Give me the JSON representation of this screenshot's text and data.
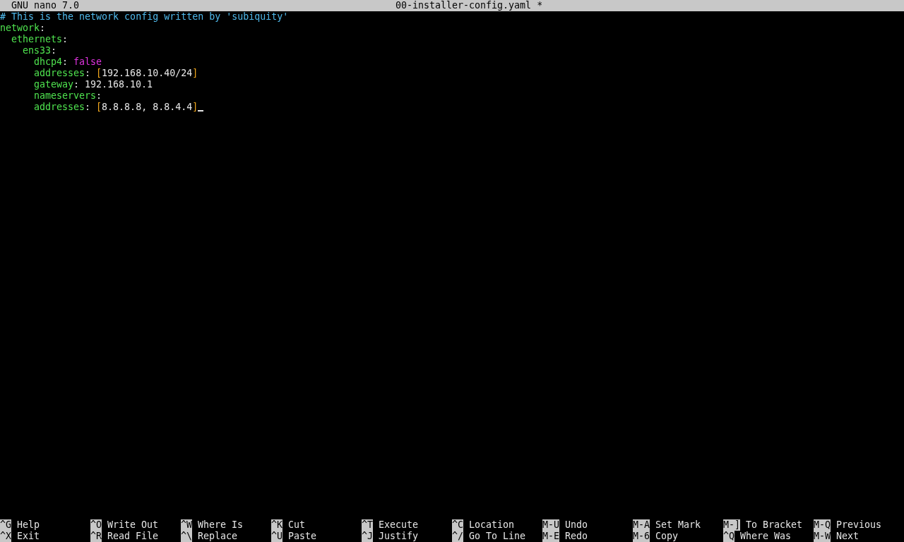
{
  "title_bar": {
    "app": "GNU nano 7.0",
    "file": "00-installer-config.yaml *"
  },
  "lines": [
    {
      "tokens": [
        {
          "kind": "comment",
          "text": "# This is the network config written by 'subiquity'"
        }
      ]
    },
    {
      "tokens": [
        {
          "kind": "key",
          "text": "network"
        },
        {
          "kind": "plain",
          "text": ":"
        }
      ],
      "children": [
        {
          "tokens": [
            {
              "kind": "key",
              "text": "ethernets"
            },
            {
              "kind": "plain",
              "text": ":"
            }
          ],
          "children": [
            {
              "tokens": [
                {
                  "kind": "key",
                  "text": "ens33"
                },
                {
                  "kind": "plain",
                  "text": ":"
                }
              ],
              "children": [
                {
                  "tokens": [
                    {
                      "kind": "key",
                      "text": "dhcp4"
                    },
                    {
                      "kind": "plain",
                      "text": ": "
                    },
                    {
                      "kind": "bool",
                      "text": "false"
                    }
                  ]
                },
                {
                  "tokens": [
                    {
                      "kind": "key",
                      "text": "addresses"
                    },
                    {
                      "kind": "plain",
                      "text": ": "
                    },
                    {
                      "kind": "bracket",
                      "text": "["
                    },
                    {
                      "kind": "plain",
                      "text": "192.168.10.40/24"
                    },
                    {
                      "kind": "bracket",
                      "text": "]"
                    }
                  ]
                },
                {
                  "tokens": [
                    {
                      "kind": "key",
                      "text": "gateway"
                    },
                    {
                      "kind": "plain",
                      "text": ": 192.168.10.1"
                    }
                  ]
                },
                {
                  "tokens": [
                    {
                      "kind": "key",
                      "text": "nameservers"
                    },
                    {
                      "kind": "plain",
                      "text": ":"
                    }
                  ]
                },
                {
                  "tokens": [
                    {
                      "kind": "key",
                      "text": "addresses"
                    },
                    {
                      "kind": "plain",
                      "text": ": "
                    },
                    {
                      "kind": "bracket",
                      "text": "["
                    },
                    {
                      "kind": "plain",
                      "text": "8.8.8.8, 8.8.4.4"
                    },
                    {
                      "kind": "bracket",
                      "text": "]"
                    }
                  ],
                  "cursor": true
                }
              ]
            }
          ]
        }
      ]
    }
  ],
  "shortcut_rows": [
    [
      {
        "key": "^G",
        "label": "Help"
      },
      {
        "key": "^O",
        "label": "Write Out"
      },
      {
        "key": "^W",
        "label": "Where Is"
      },
      {
        "key": "^K",
        "label": "Cut"
      },
      {
        "key": "^T",
        "label": "Execute"
      },
      {
        "key": "^C",
        "label": "Location"
      },
      {
        "key": "M-U",
        "label": "Undo"
      },
      {
        "key": "M-A",
        "label": "Set Mark"
      },
      {
        "key": "M-]",
        "label": "To Bracket"
      },
      {
        "key": "M-Q",
        "label": "Previous"
      }
    ],
    [
      {
        "key": "^X",
        "label": "Exit"
      },
      {
        "key": "^R",
        "label": "Read File"
      },
      {
        "key": "^\\",
        "label": "Replace"
      },
      {
        "key": "^U",
        "label": "Paste"
      },
      {
        "key": "^J",
        "label": "Justify"
      },
      {
        "key": "^/",
        "label": "Go To Line"
      },
      {
        "key": "M-E",
        "label": "Redo"
      },
      {
        "key": "M-6",
        "label": "Copy"
      },
      {
        "key": "^Q",
        "label": "Where Was"
      },
      {
        "key": "M-W",
        "label": "Next"
      }
    ]
  ]
}
